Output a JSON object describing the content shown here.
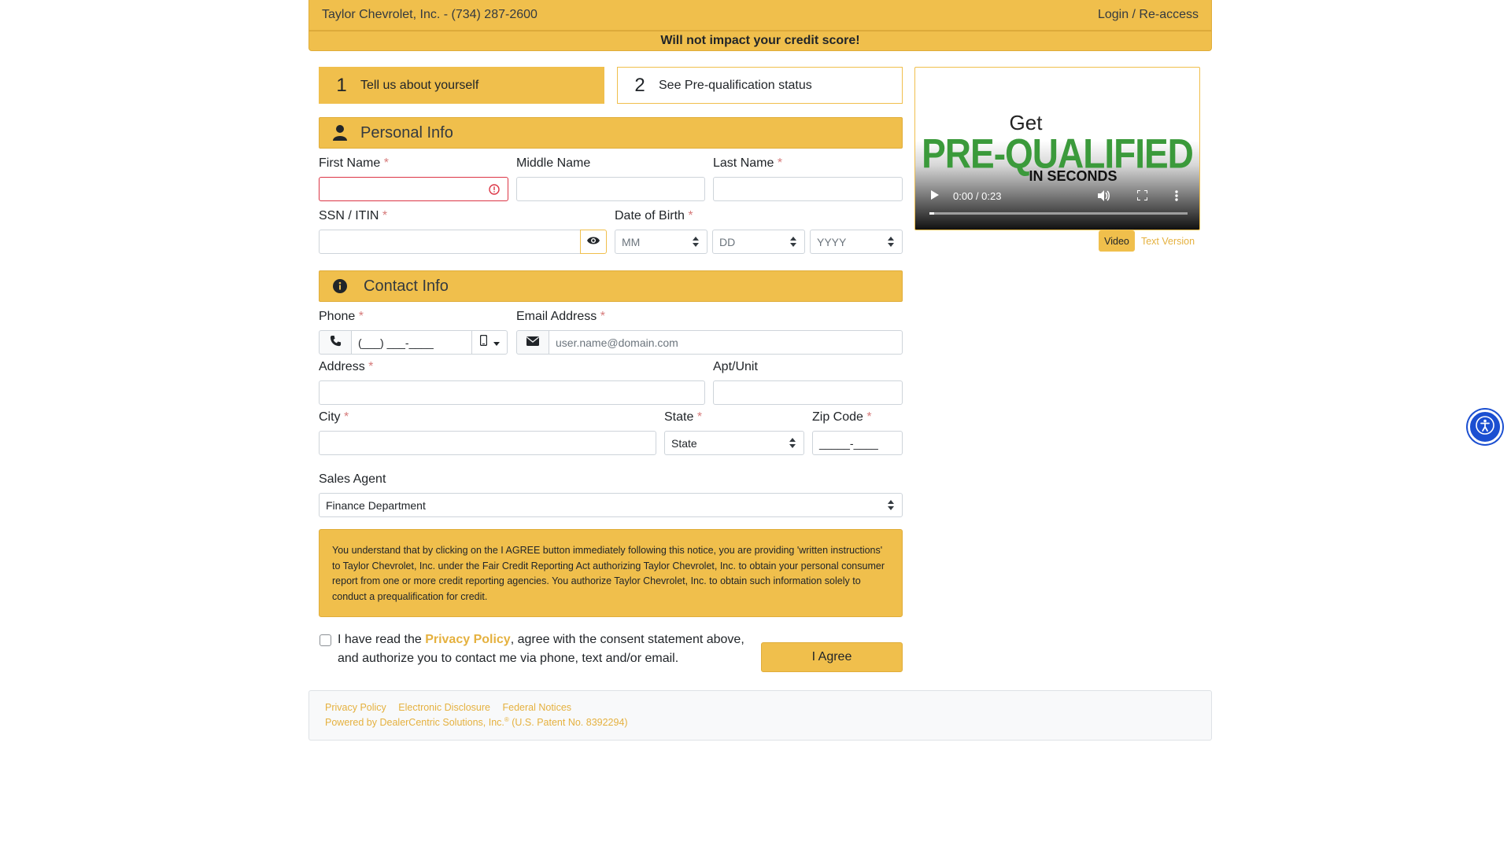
{
  "header": {
    "dealer": "Taylor Chevrolet, Inc. - (734) 287-2600",
    "login": "Login / Re-access",
    "notice": "Will not impact your credit score!"
  },
  "steps": [
    {
      "num": "1",
      "label": "Tell us about yourself"
    },
    {
      "num": "2",
      "label": "See Pre-qualification status"
    }
  ],
  "personal": {
    "title": "Personal Info",
    "first_name": "First Name",
    "middle_name": "Middle Name",
    "last_name": "Last Name",
    "ssn": "SSN / ITIN",
    "dob": "Date of Birth",
    "dob_mm": "MM",
    "dob_dd": "DD",
    "dob_yyyy": "YYYY",
    "required_mark": "*"
  },
  "contact": {
    "title": "Contact Info",
    "phone": "Phone",
    "phone_mask": "(___) ___-____",
    "email": "Email Address",
    "email_placeholder": "user.name@domain.com",
    "address": "Address",
    "apt": "Apt/Unit",
    "city": "City",
    "state": "State",
    "state_placeholder": "State",
    "zip": "Zip Code",
    "zip_mask": "_____-____"
  },
  "sales": {
    "label": "Sales Agent",
    "value": "Finance Department"
  },
  "consent_text": "You understand that by clicking on the I AGREE button immediately following this notice, you are providing 'written instructions' to Taylor Chevrolet, Inc. under the Fair Credit Reporting Act authorizing Taylor Chevrolet, Inc. to obtain your personal consumer report from one or more credit reporting agencies. You authorize Taylor Chevrolet, Inc. to obtain such information solely to conduct a prequalification for credit.",
  "agree": {
    "prefix": "I have read the ",
    "link": "Privacy Policy",
    "suffix": ", agree with the consent statement above, and authorize you to contact me via phone, text and/or email.",
    "button": "I Agree"
  },
  "footer": {
    "links": [
      "Privacy Policy",
      "Electronic Disclosure",
      "Federal Notices"
    ],
    "powered": "Powered by DealerCentric Solutions, Inc.",
    "reg": "®",
    "patent": " (U.S. Patent No. 8392294)"
  },
  "video": {
    "get": "Get",
    "prequalified": "PRE-QUALIFIED",
    "seconds": "IN SECONDS",
    "time": "0:00 / 0:23",
    "progress": 0.0,
    "tab_video": "Video",
    "tab_text": "Text Version"
  },
  "colors": {
    "accent": "#f0bf4c",
    "link": "#e5b13f",
    "required": "#d67a7a",
    "accessibility": "#1b4fd1"
  }
}
